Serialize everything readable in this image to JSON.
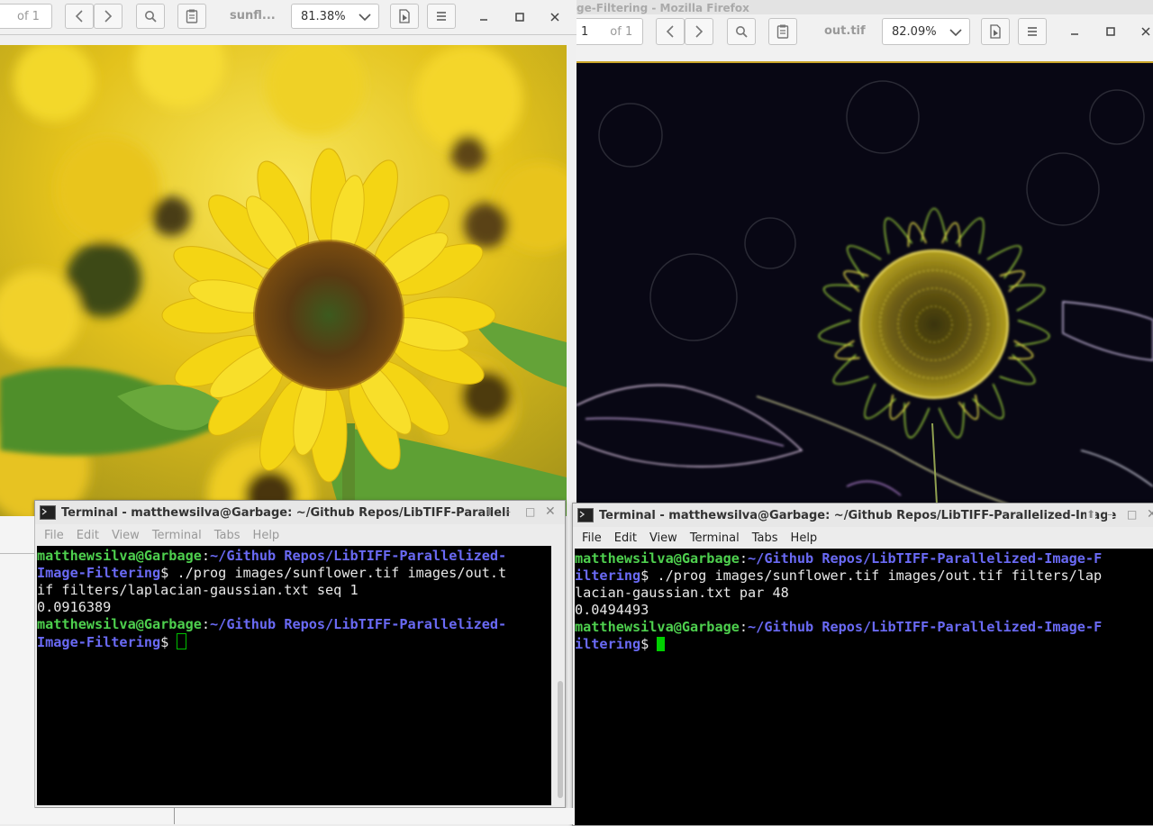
{
  "left_viewer": {
    "page_of": "of 1",
    "doc_title": "sunfl...",
    "zoom": "81.38%"
  },
  "right_viewer": {
    "window_title": "ge-Filtering - Mozilla Firefox",
    "page_number": "1",
    "page_of": "of 1",
    "doc_title": "out.tif",
    "zoom": "82.09%"
  },
  "left_terminal": {
    "title": "Terminal - matthewsilva@Garbage: ~/Github Repos/LibTIFF-Paralleli",
    "menu": [
      "File",
      "Edit",
      "View",
      "Terminal",
      "Tabs",
      "Help"
    ],
    "lines": [
      {
        "user": "matthewsilva@Garbage",
        "sep": ":",
        "path": "~/Github Repos/LibTIFF-Parallelized-",
        "rest": ""
      },
      {
        "user": "",
        "sep": "",
        "path": "Image-Filtering",
        "rest": "$ ./prog images/sunflower.tif images/out.t"
      },
      {
        "user": "",
        "sep": "",
        "path": "",
        "rest": "if filters/laplacian-gaussian.txt seq 1"
      },
      {
        "user": "",
        "sep": "",
        "path": "",
        "rest": "0.0916389"
      },
      {
        "user": "matthewsilva@Garbage",
        "sep": ":",
        "path": "~/Github Repos/LibTIFF-Parallelized-",
        "rest": ""
      },
      {
        "user": "",
        "sep": "",
        "path": "Image-Filtering",
        "rest": "$ "
      }
    ]
  },
  "right_terminal": {
    "title": "Terminal - matthewsilva@Garbage: ~/Github Repos/LibTIFF-Parallelized-Image",
    "menu": [
      "File",
      "Edit",
      "View",
      "Terminal",
      "Tabs",
      "Help"
    ],
    "lines": [
      {
        "user": "matthewsilva@Garbage",
        "sep": ":",
        "path": "~/Github Repos/LibTIFF-Parallelized-Image-F",
        "rest": ""
      },
      {
        "user": "",
        "sep": "",
        "path": "iltering",
        "rest": "$ ./prog images/sunflower.tif images/out.tif filters/lap"
      },
      {
        "user": "",
        "sep": "",
        "path": "",
        "rest": "lacian-gaussian.txt par 48"
      },
      {
        "user": "",
        "sep": "",
        "path": "",
        "rest": "0.0494493"
      },
      {
        "user": "matthewsilva@Garbage",
        "sep": ":",
        "path": "~/Github Repos/LibTIFF-Parallelized-Image-F",
        "rest": ""
      },
      {
        "user": "",
        "sep": "",
        "path": "iltering",
        "rest": "$ "
      }
    ]
  },
  "colors": {
    "prompt_user": "#4ed04e",
    "prompt_path": "#6a6af5",
    "terminal_bg": "#000000",
    "cursor_left": "#00c000",
    "cursor_right": "#00d000"
  },
  "icons": [
    "search-icon",
    "sidebar-toggle-icon",
    "chevron-left-icon",
    "chevron-right-icon",
    "chevron-down-icon",
    "presentation-icon",
    "hamburger-menu-icon",
    "minimize-icon",
    "maximize-icon",
    "close-icon",
    "terminal-icon"
  ]
}
